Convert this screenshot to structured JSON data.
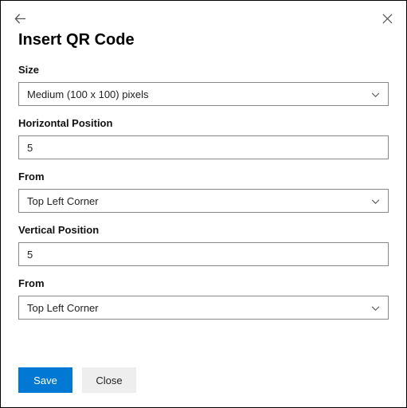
{
  "dialog": {
    "title": "Insert QR Code",
    "fields": {
      "size": {
        "label": "Size",
        "value": "Medium (100 x 100) pixels"
      },
      "hpos": {
        "label": "Horizontal Position",
        "value": "5"
      },
      "hfrom": {
        "label": "From",
        "value": "Top Left Corner"
      },
      "vpos": {
        "label": "Vertical Position",
        "value": "5"
      },
      "vfrom": {
        "label": "From",
        "value": "Top Left Corner"
      }
    },
    "buttons": {
      "save": "Save",
      "close": "Close"
    }
  }
}
